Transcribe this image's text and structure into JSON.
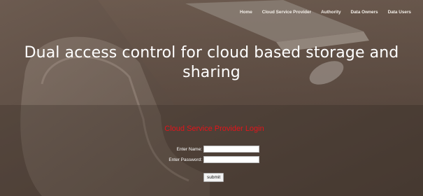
{
  "nav": {
    "items": [
      {
        "label": "Home"
      },
      {
        "label": "Cloud Service Provider"
      },
      {
        "label": "Authority"
      },
      {
        "label": "Data Owners"
      },
      {
        "label": "Data Users"
      }
    ]
  },
  "hero": {
    "title_line1": "Dual access control for cloud based storage and",
    "title_line2": "sharing"
  },
  "login": {
    "title": "Cloud Service Provider Login",
    "name_label": "Enter Name:",
    "name_value": "",
    "password_label": "Enter Password:",
    "password_value": "",
    "submit_label": "submit"
  },
  "colors": {
    "login_title": "#e3141b",
    "nav_text": "#f4efe9",
    "background": "#5a4b42"
  }
}
